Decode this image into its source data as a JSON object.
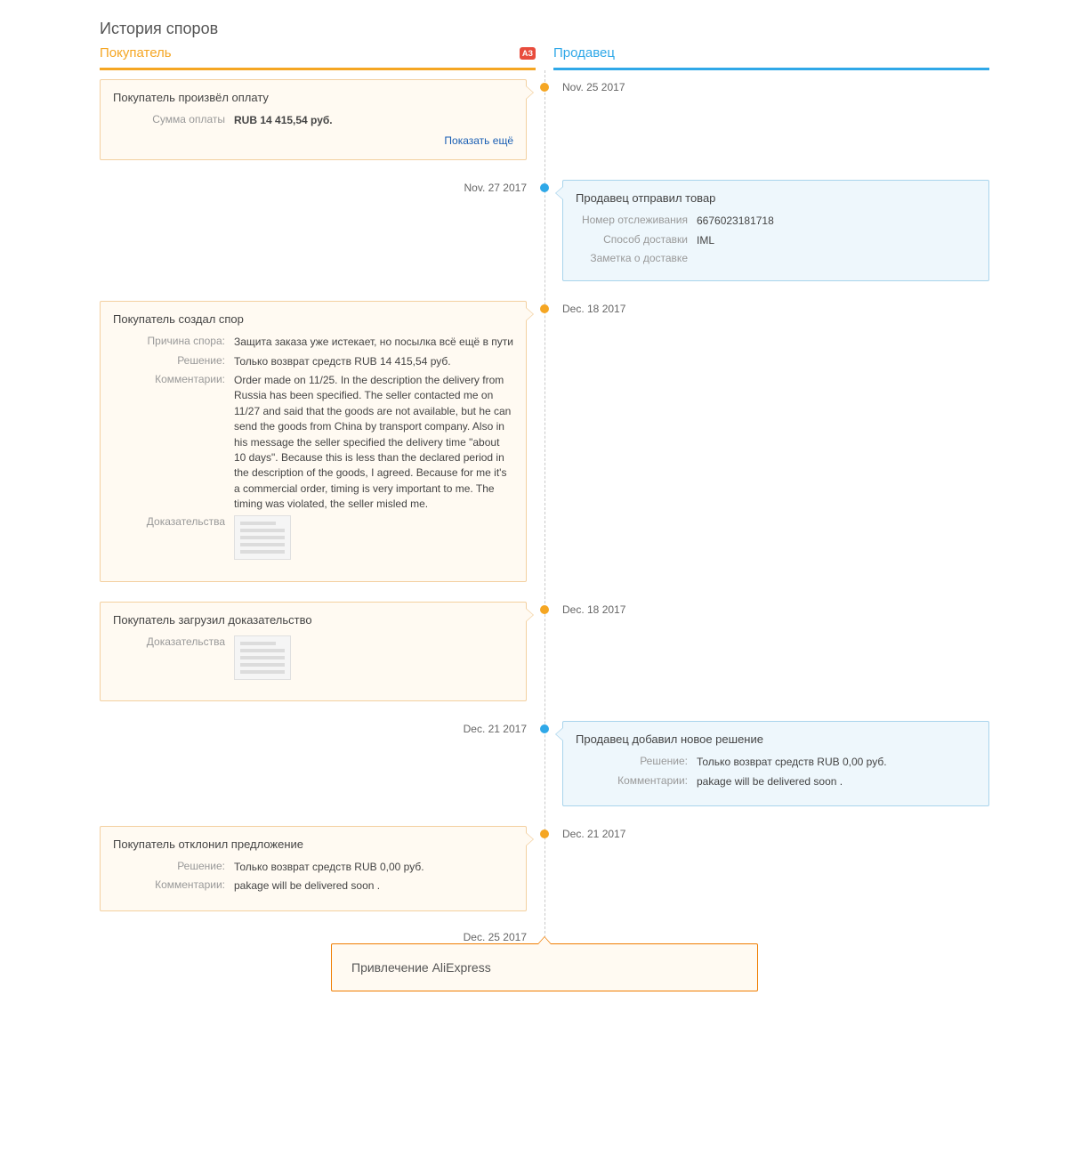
{
  "page_title": "История споров",
  "buyer_label": "Покупатель",
  "seller_label": "Продавец",
  "badge_text": "АЗ",
  "entries": [
    {
      "side": "buyer",
      "date": "Nov. 25 2017",
      "title": "Покупатель произвёл оплату",
      "rows": [
        {
          "label": "Сумма оплаты",
          "value": "RUB 14 415,54 руб.",
          "bold": true
        }
      ],
      "show_more": "Показать ещё"
    },
    {
      "side": "seller",
      "date": "Nov. 27 2017",
      "title": "Продавец отправил товар",
      "rows": [
        {
          "label": "Номер отслеживания",
          "value": "6676023181718"
        },
        {
          "label": "Способ доставки",
          "value": "IML"
        },
        {
          "label": "Заметка о доставке",
          "value": ""
        }
      ]
    },
    {
      "side": "buyer",
      "date": "Dec. 18 2017",
      "title": "Покупатель создал спор",
      "rows": [
        {
          "label": "Причина спора:",
          "value": "Защита заказа уже истекает, но посылка всё ещё в пути"
        },
        {
          "label": "Решение:",
          "value": "Только возврат средств RUB 14 415,54 руб."
        },
        {
          "label": "Комментарии:",
          "value": "Order made on 11/25. In the description the delivery from Russia has been specified. The seller contacted me on 11/27 and said that the goods are not available, but he can send the goods from China by transport company. Also in his message the seller specified the delivery time \"about 10 days\". Because this is less than the declared period in the description of the goods, I agreed. Because for me it's a commercial order, timing is very important to me. The timing was violated, the seller misled me."
        },
        {
          "label": "Доказательства",
          "thumb": true
        }
      ]
    },
    {
      "side": "buyer",
      "date": "Dec. 18 2017",
      "title": "Покупатель загрузил доказательство",
      "rows": [
        {
          "label": "Доказательства",
          "thumb": true
        }
      ]
    },
    {
      "side": "seller",
      "date": "Dec. 21 2017",
      "title": "Продавец добавил новое решение",
      "rows": [
        {
          "label": "Решение:",
          "value": "Только возврат средств RUB 0,00 руб."
        },
        {
          "label": "Комментарии:",
          "value": "pakage will be delivered soon ."
        }
      ]
    },
    {
      "side": "buyer",
      "date": "Dec. 21 2017",
      "title": "Покупатель отклонил предложение",
      "rows": [
        {
          "label": "Решение:",
          "value": "Только возврат средств RUB 0,00 руб."
        },
        {
          "label": "Комментарии:",
          "value": "pakage will be delivered soon ."
        }
      ]
    }
  ],
  "center_entry": {
    "date": "Dec. 25 2017",
    "title": "Привлечение AliExpress"
  }
}
